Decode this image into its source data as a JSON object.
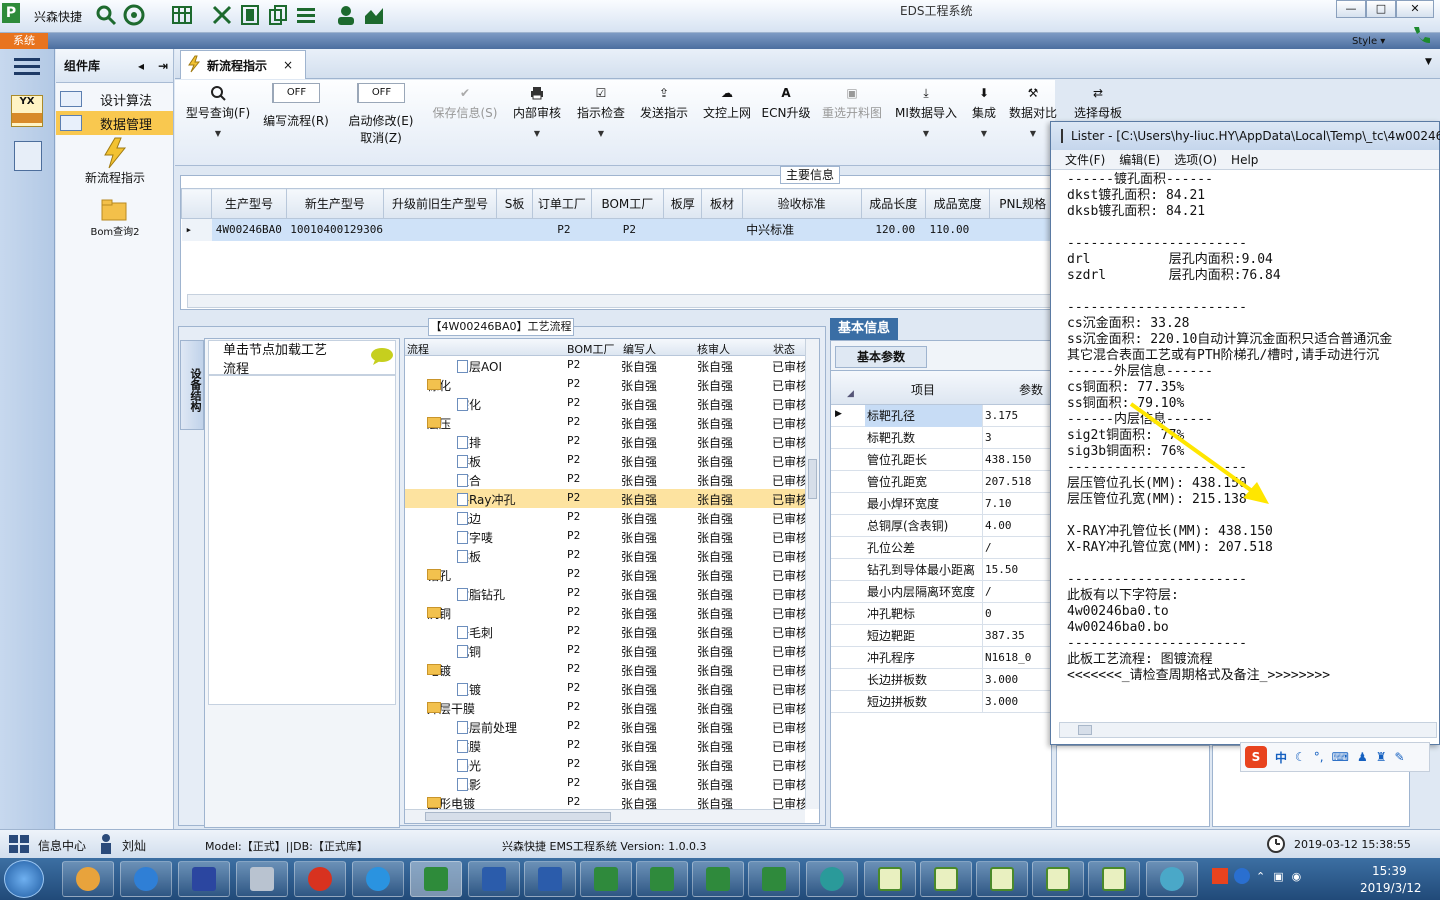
{
  "titlebar": {
    "app_name": "兴森快捷",
    "window_title": "EDS工程系统",
    "min": "—",
    "max": "□",
    "close": "✕",
    "style_label": "Style ▾"
  },
  "system_tab": "系统",
  "component_lib": {
    "title": "组件库",
    "tree": [
      {
        "label": "设计算法"
      },
      {
        "label": "数据管理",
        "selected": true
      }
    ],
    "big_items": [
      {
        "label": "新流程指示"
      },
      {
        "label": "Bom查询2"
      }
    ]
  },
  "doc_tab": {
    "label": "新流程指示",
    "close": "×"
  },
  "ribbon": {
    "buttons": [
      {
        "label": "型号查询(F)",
        "icon": "search-icon"
      },
      {
        "label": "编写流程(R)",
        "toggle": "OFF"
      },
      {
        "label": "启动修改(E)",
        "label2": "取消(Z)",
        "toggle": "OFF"
      },
      {
        "label": "保存信息(S)",
        "icon": "check-icon",
        "disabled": true
      },
      {
        "label": "内部审核",
        "icon": "printer-icon"
      },
      {
        "label": "指示检查",
        "icon": "checkbox-icon"
      },
      {
        "label": "发送指示",
        "icon": "upload-icon"
      },
      {
        "label": "文控上网",
        "icon": "cloud-upload-icon"
      },
      {
        "label": "ECN升级",
        "icon": "ecn-icon"
      },
      {
        "label": "重选开料图",
        "icon": "image-icon",
        "disabled": true
      },
      {
        "label": "MI数据导入",
        "icon": "import-icon"
      },
      {
        "label": "集成",
        "icon": "download-icon"
      },
      {
        "label": "数据对比",
        "icon": "compare-icon"
      },
      {
        "label": "选择母板",
        "icon": "shuffle-icon"
      }
    ]
  },
  "main_info": {
    "legend": "主要信息",
    "columns": [
      "生产型号",
      "新生产型号",
      "升级前旧生产型号",
      "S板",
      "订单工厂",
      "BOM工厂",
      "板厚",
      "板材",
      "验收标准",
      "成品长度",
      "成品宽度",
      "PNL规格"
    ],
    "row": [
      "4W00246BA0",
      "10010400129306",
      "",
      "",
      "P2",
      "P2",
      "",
      "",
      "中兴标准",
      "120.00",
      "110.00",
      ""
    ]
  },
  "flow_panel": {
    "legend": "【4W00246BA0】工艺流程",
    "vertical_tab": "设备结构",
    "load_button": "单击节点加载工艺流程",
    "columns": [
      "流程",
      "BOM工厂",
      "编写人",
      "核审人",
      "状态"
    ],
    "rows": [
      {
        "name": "内层AOI",
        "level": 2,
        "bom": "P2",
        "writer": "张自强",
        "reviewer": "张自强",
        "status": "已审核"
      },
      {
        "name": "棕化",
        "level": 1,
        "bom": "P2",
        "writer": "张自强",
        "reviewer": "张自强",
        "status": "已审核"
      },
      {
        "name": "棕化",
        "level": 2,
        "bom": "P2",
        "writer": "张自强",
        "reviewer": "张自强",
        "status": "已审核"
      },
      {
        "name": "层压",
        "level": 1,
        "bom": "P2",
        "writer": "张自强",
        "reviewer": "张自强",
        "status": "已审核"
      },
      {
        "name": "预排",
        "level": 2,
        "bom": "P2",
        "writer": "张自强",
        "reviewer": "张自强",
        "status": "已审核"
      },
      {
        "name": "排板",
        "level": 2,
        "bom": "P2",
        "writer": "张自强",
        "reviewer": "张自强",
        "status": "已审核"
      },
      {
        "name": "压合",
        "level": 2,
        "bom": "P2",
        "writer": "张自强",
        "reviewer": "张自强",
        "status": "已审核"
      },
      {
        "name": "X-Ray冲孔",
        "level": 2,
        "bom": "P2",
        "writer": "张自强",
        "reviewer": "张自强",
        "status": "已审核",
        "selected": true
      },
      {
        "name": "铣边",
        "level": 2,
        "bom": "P2",
        "writer": "张自强",
        "reviewer": "张自强",
        "status": "已审核"
      },
      {
        "name": "打字唛",
        "level": 2,
        "bom": "P2",
        "writer": "张自强",
        "reviewer": "张自强",
        "status": "已审核"
      },
      {
        "name": "烘板",
        "level": 2,
        "bom": "P2",
        "writer": "张自强",
        "reviewer": "张自强",
        "status": "已审核"
      },
      {
        "name": "钻孔",
        "level": 1,
        "bom": "P2",
        "writer": "张自强",
        "reviewer": "张自强",
        "status": "已审核"
      },
      {
        "name": "树脂钻孔",
        "level": 2,
        "bom": "P2",
        "writer": "张自强",
        "reviewer": "张自强",
        "status": "已审核"
      },
      {
        "name": "沉铜",
        "level": 1,
        "bom": "P2",
        "writer": "张自强",
        "reviewer": "张自强",
        "status": "已审核"
      },
      {
        "name": "去毛刺",
        "level": 2,
        "bom": "P2",
        "writer": "张自强",
        "reviewer": "张自强",
        "status": "已审核"
      },
      {
        "name": "沉铜",
        "level": 2,
        "bom": "P2",
        "writer": "张自强",
        "reviewer": "张自强",
        "status": "已审核"
      },
      {
        "name": "电镀",
        "level": 1,
        "bom": "P2",
        "writer": "张自强",
        "reviewer": "张自强",
        "status": "已审核"
      },
      {
        "name": "板镀",
        "level": 2,
        "bom": "P2",
        "writer": "张自强",
        "reviewer": "张自强",
        "status": "已审核"
      },
      {
        "name": "外层干膜",
        "level": 1,
        "bom": "P2",
        "writer": "张自强",
        "reviewer": "张自强",
        "status": "已审核"
      },
      {
        "name": "外层前处理",
        "level": 2,
        "bom": "P2",
        "writer": "张自强",
        "reviewer": "张自强",
        "status": "已审核"
      },
      {
        "name": "贴膜",
        "level": 2,
        "bom": "P2",
        "writer": "张自强",
        "reviewer": "张自强",
        "status": "已审核"
      },
      {
        "name": "曝光",
        "level": 2,
        "bom": "P2",
        "writer": "张自强",
        "reviewer": "张自强",
        "status": "已审核"
      },
      {
        "name": "显影",
        "level": 2,
        "bom": "P2",
        "writer": "张自强",
        "reviewer": "张自强",
        "status": "已审核"
      },
      {
        "name": "图形电镀",
        "level": 1,
        "bom": "P2",
        "writer": "张自强",
        "reviewer": "张自强",
        "status": "已审核"
      }
    ]
  },
  "basic_info": {
    "tab": "基本信息",
    "subtab": "基本参数",
    "col_item": "项目",
    "col_param": "参数",
    "rows": [
      [
        "标靶孔径",
        "3.175"
      ],
      [
        "标靶孔数",
        "3"
      ],
      [
        "管位孔距长",
        "438.150"
      ],
      [
        "管位孔距宽",
        "207.518"
      ],
      [
        "最小焊环宽度",
        "7.10"
      ],
      [
        "总铜厚(含表铜)",
        "4.00"
      ],
      [
        "孔位公差",
        "/"
      ],
      [
        "钻孔到导体最小距离",
        "15.50"
      ],
      [
        "最小内层隔离环宽度",
        "/"
      ],
      [
        "冲孔靶标",
        "0"
      ],
      [
        "短边靶距",
        "387.35"
      ],
      [
        "冲孔程序",
        "N1618_0"
      ],
      [
        "长边拼板数",
        "3.000"
      ],
      [
        "短边拼板数",
        "3.000"
      ]
    ]
  },
  "lister": {
    "title": "Lister - [C:\\Users\\hy-liuc.HY\\AppData\\Local\\Temp\\_tc\\4w00246",
    "menu": [
      "文件(F)",
      "编辑(E)",
      "选项(O)",
      "Help"
    ],
    "lines": [
      "------镀孔面积------",
      "dkst镀孔面积: 84.21",
      "dksb镀孔面积: 84.21",
      "",
      "-----------------------",
      "drl          层孔内面积:9.04",
      "szdrl        层孔内面积:76.84",
      "",
      "-----------------------",
      "cs沉金面积: 33.28",
      "ss沉金面积: 220.10自动计算沉金面积只适合普通沉金",
      "其它混合表面工艺或有PTH阶梯孔/槽时,请手动进行沉",
      "------外层信息------",
      "cs铜面积: 77.35%",
      "ss铜面积: 79.10%",
      "------内层信息------",
      "sig2t铜面积: 77%",
      "sig3b铜面积: 76%",
      "-----------------------",
      "层压管位孔长(MM): 438.150",
      "层压管位孔宽(MM): 215.138",
      "",
      "X-RAY冲孔管位长(MM): 438.150",
      "X-RAY冲孔管位宽(MM): 207.518",
      "",
      "-----------------------",
      "此板有以下字符层:",
      "4w00246ba0.to",
      "4w00246ba0.bo",
      "-----------------------",
      "此板工艺流程: 图镀流程",
      "<<<<<<<_请检查周期格式及备注_>>>>>>>>"
    ]
  },
  "ime": {
    "zh": "中"
  },
  "status": {
    "info_center": "信息中心",
    "user": "刘灿",
    "model": "Model:【正式】||DB:【正式库】",
    "version": "兴森快捷  EMS工程系统  Version: 1.0.0.3",
    "datetime": "2019-03-12  15:38:55"
  },
  "taskbar": {
    "time": "15:39",
    "date": "2019/3/12"
  }
}
